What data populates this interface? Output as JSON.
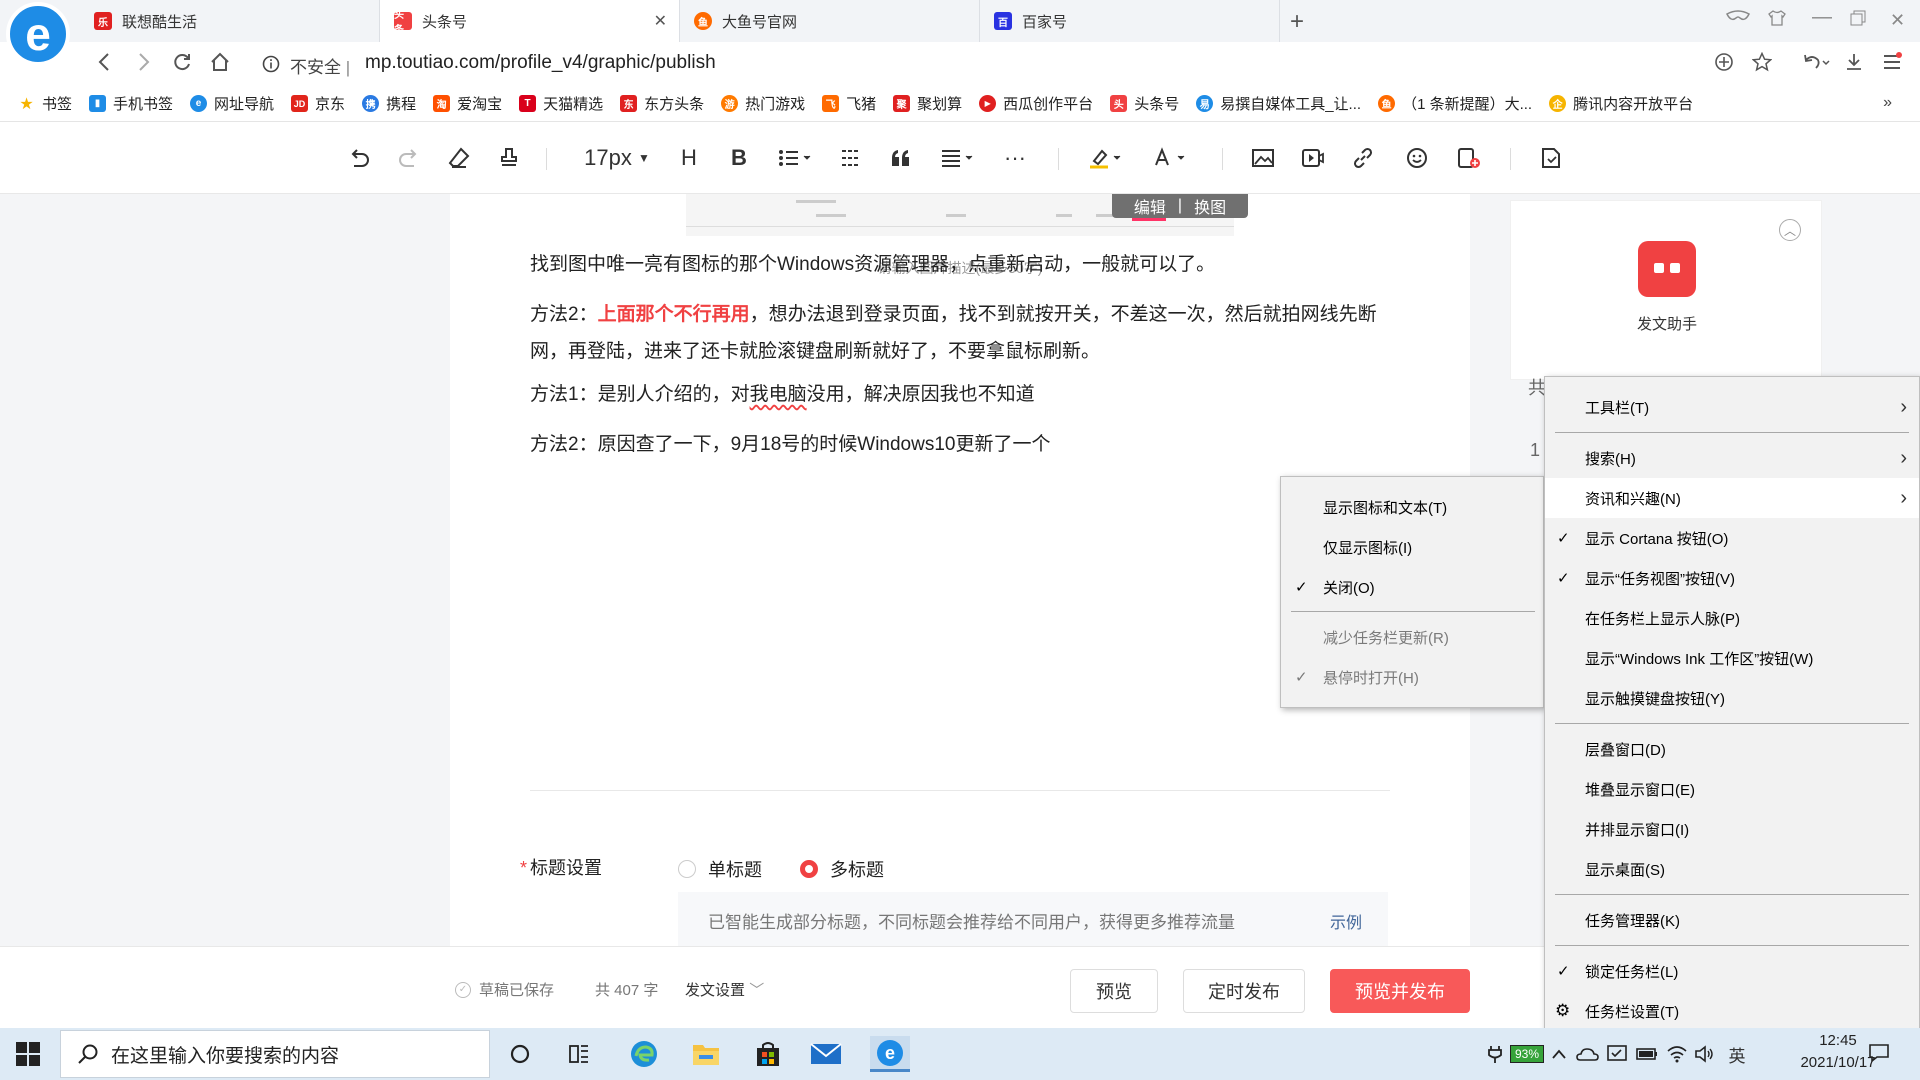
{
  "browser": {
    "tabs": [
      {
        "title": "联想酷生活",
        "fav_color": "#e02020",
        "fav_text": "乐"
      },
      {
        "title": "头条号",
        "fav_color": "#f04142",
        "fav_text": "头条",
        "active": true
      },
      {
        "title": "大鱼号官网",
        "fav_color": "#ff6a00",
        "fav_text": "鱼"
      },
      {
        "title": "百家号",
        "fav_color": "#2932e1",
        "fav_text": "百"
      }
    ],
    "security_label": "不安全",
    "url": "mp.toutiao.com/profile_v4/graphic/publish",
    "bookmarks": [
      {
        "label": "书签",
        "color": "#f6b400",
        "icon": "★"
      },
      {
        "label": "手机书签",
        "color": "#1e8ce6",
        "icon": "▮"
      },
      {
        "label": "网址导航",
        "color": "#1e8ce6",
        "icon": "e"
      },
      {
        "label": "京东",
        "color": "#e1251b",
        "icon": "JD"
      },
      {
        "label": "携程",
        "color": "#2a7ae2",
        "icon": "携"
      },
      {
        "label": "爱淘宝",
        "color": "#ff5000",
        "icon": "淘"
      },
      {
        "label": "天猫精选",
        "color": "#d9001b",
        "icon": "T"
      },
      {
        "label": "东方头条",
        "color": "#e02020",
        "icon": "东"
      },
      {
        "label": "热门游戏",
        "color": "#ff7a00",
        "icon": "游"
      },
      {
        "label": "飞猪",
        "color": "#ff6a00",
        "icon": "飞"
      },
      {
        "label": "聚划算",
        "color": "#e02020",
        "icon": "聚"
      },
      {
        "label": "西瓜创作平台",
        "color": "#e02020",
        "icon": "▶"
      },
      {
        "label": "头条号",
        "color": "#f04142",
        "icon": "头"
      },
      {
        "label": "易撰自媒体工具_让...",
        "color": "#1e8ce6",
        "icon": "易"
      },
      {
        "label": "（1 条新提醒）大...",
        "color": "#ff6a00",
        "icon": "鱼"
      },
      {
        "label": "腾讯内容开放平台",
        "color": "#f6b400",
        "icon": "企"
      }
    ]
  },
  "toolbar": {
    "font_size": "17px"
  },
  "editor": {
    "image_overlay_edit": "编辑",
    "image_overlay_sep": "|",
    "image_overlay_replace": "换图",
    "caption_placeholder": "请输入图片描述(最多50字)",
    "p1": "找到图中唯一亮有图标的那个Windows资源管理器，点重新启动，一般就可以了。",
    "p2_prefix": "方法2：",
    "p2_red": "上面那个不行再用",
    "p2_rest": "，想办法退到登录页面，找不到就按开关，不差这一次，然后就拍网线先断网，再登陆，进来了还卡就脸滚键盘刷新就好了，不要拿鼠标刷新。",
    "p3_a": "方法1：是别人介绍的，对",
    "p3_squig": "我电脑",
    "p3_b": "没用，解决原因我也不知道",
    "p4": "方法2：原因查了一下，9月18号的时候Windows10更新了一个",
    "title_setting_label": "标题设置",
    "radio_single": "单标题",
    "radio_multi": "多标题",
    "multi_selected": true,
    "hint": "已智能生成部分标题，不同标题会推荐给不同用户，获得更多推荐流量",
    "hint_example": "示例"
  },
  "assistant": {
    "label": "发文助手",
    "peek_text_1": "共",
    "peek_text_2": "1"
  },
  "bottom": {
    "saved": "草稿已保存",
    "wordcount": "共 407 字",
    "publish_settings": "发文设置",
    "preview": "预览",
    "scheduled": "定时发布",
    "preview_publish": "预览并发布"
  },
  "submenu": {
    "items": [
      {
        "label": "显示图标和文本(T)",
        "checked": false,
        "disabled": false
      },
      {
        "label": "仅显示图标(I)",
        "checked": false,
        "disabled": false
      },
      {
        "label": "关闭(O)",
        "checked": true,
        "disabled": false
      },
      {
        "label": "减少任务栏更新(R)",
        "checked": false,
        "disabled": true
      },
      {
        "label": "悬停时打开(H)",
        "checked": true,
        "disabled": true
      }
    ]
  },
  "taskbar_menu": {
    "items": [
      {
        "label": "工具栏(T)",
        "arrow": true
      },
      {
        "label": "搜索(H)",
        "arrow": true
      },
      {
        "label": "资讯和兴趣(N)",
        "arrow": true,
        "highlighted": true
      },
      {
        "label": "显示 Cortana 按钮(O)",
        "checked": true
      },
      {
        "label": "显示“任务视图”按钮(V)",
        "checked": true
      },
      {
        "label": "在任务栏上显示人脉(P)"
      },
      {
        "label": "显示“Windows Ink 工作区”按钮(W)"
      },
      {
        "label": "显示触摸键盘按钮(Y)"
      },
      {
        "label": "层叠窗口(D)"
      },
      {
        "label": "堆叠显示窗口(E)"
      },
      {
        "label": "并排显示窗口(I)"
      },
      {
        "label": "显示桌面(S)"
      },
      {
        "label": "任务管理器(K)"
      },
      {
        "label": "锁定任务栏(L)",
        "checked": true
      },
      {
        "label": "任务栏设置(T)",
        "gear": true
      }
    ]
  },
  "taskbar": {
    "search_placeholder": "在这里输入你要搜索的内容",
    "battery": "93%",
    "ime": "英",
    "time": "12:45",
    "date": "2021/10/17"
  }
}
